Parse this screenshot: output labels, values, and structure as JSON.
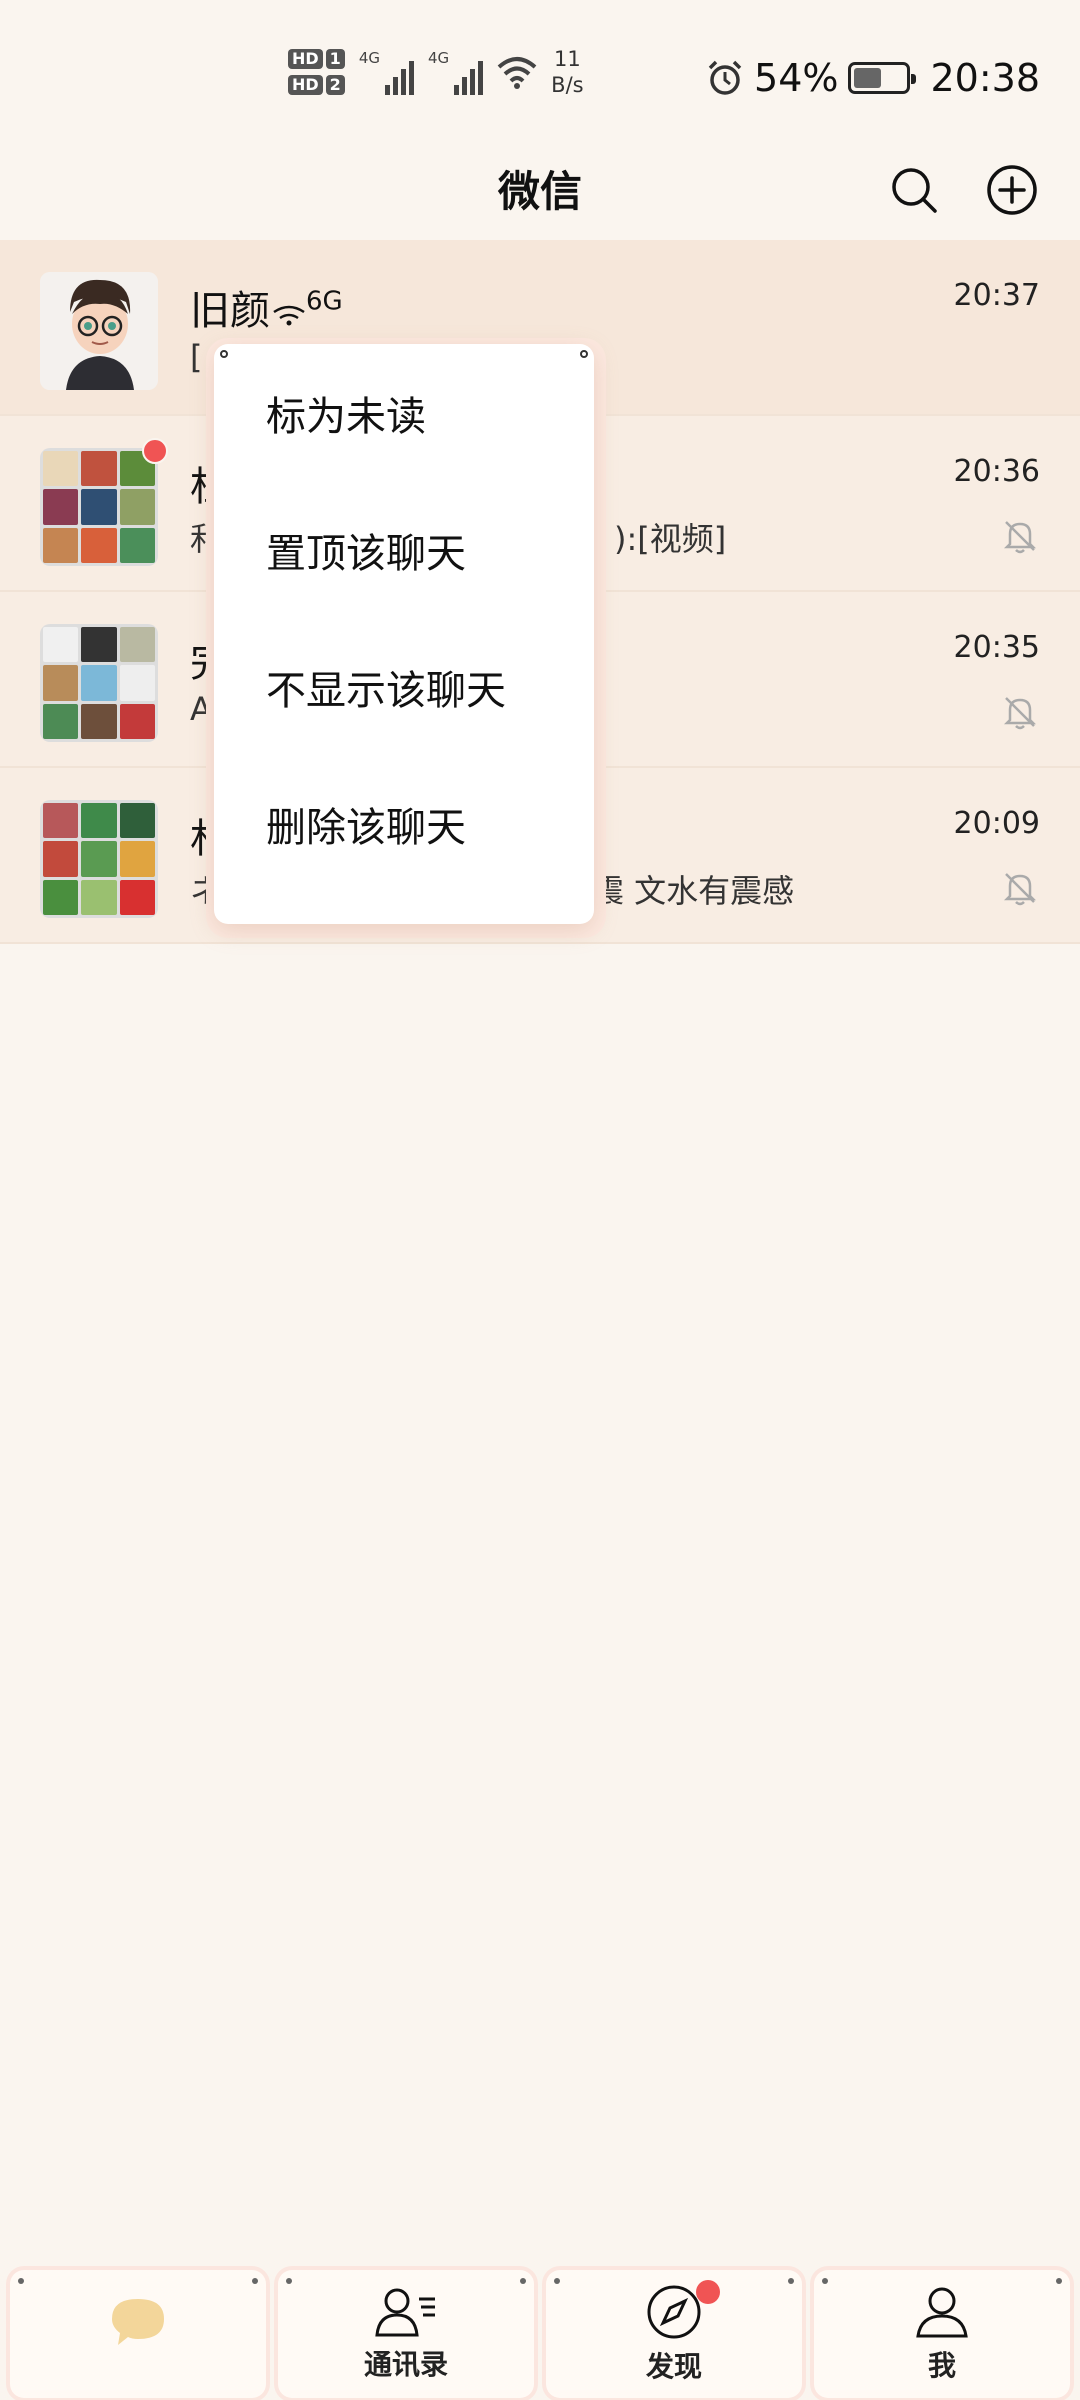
{
  "status_bar": {
    "sim1": "HD",
    "sim1_num": "1",
    "sim2": "HD",
    "sim2_num": "2",
    "net1": "4G",
    "net2": "4G",
    "speed_value": "11",
    "speed_unit": "B/s",
    "battery_percent": "54%",
    "battery_level": 0.54,
    "time": "20:38"
  },
  "header": {
    "title": "微信"
  },
  "chats": [
    {
      "name": "旧颜",
      "name_suffix": "6G",
      "preview": "[",
      "time": "20:37",
      "muted": false
    },
    {
      "name": "杜",
      "preview_head": "和",
      "preview_tail": "):[视频]",
      "time": "20:36",
      "muted": true,
      "unread_dot": true
    },
    {
      "name": "完",
      "preview_head": "A",
      "preview_tail": "",
      "time": "20:35",
      "muted": true
    },
    {
      "name": "杉",
      "preview_head": "ネ",
      "preview_tail": "震 文水有震感",
      "time": "20:09",
      "muted": true
    }
  ],
  "context_menu": {
    "items": [
      "标为未读",
      "置顶该聊天",
      "不显示该聊天",
      "删除该聊天"
    ]
  },
  "tab_bar": {
    "chats_label": "",
    "contacts_label": "通讯录",
    "discover_label": "发现",
    "me_label": "我"
  },
  "colors": {
    "background": "#faf5ef",
    "row_background": "#f8ede3",
    "badge_red": "#f05454"
  }
}
